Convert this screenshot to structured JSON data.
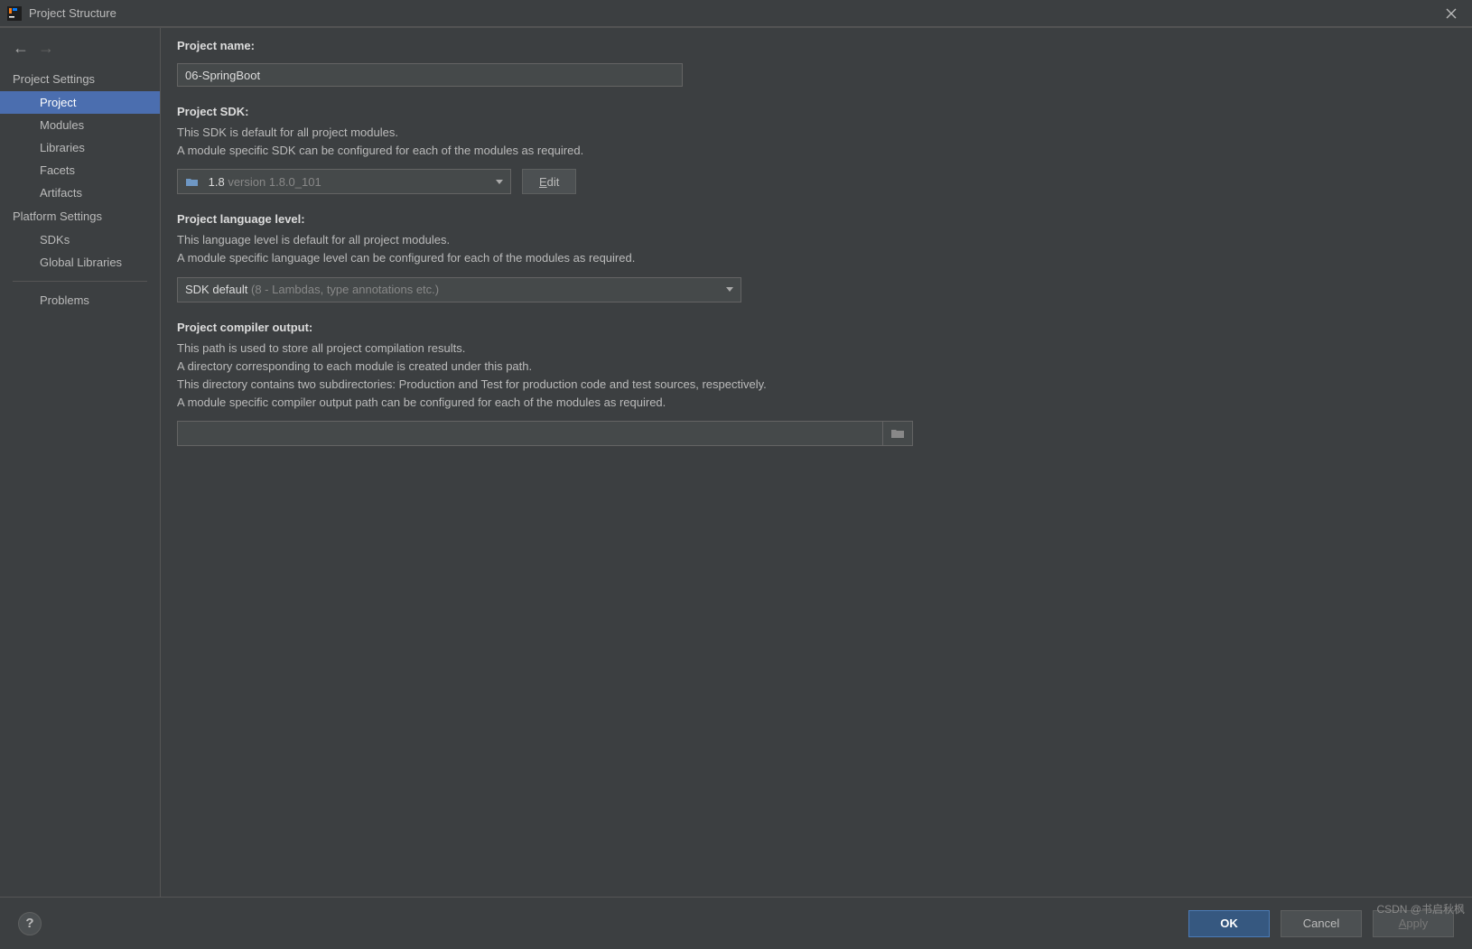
{
  "title": "Project Structure",
  "sidebar": {
    "heading1": "Project Settings",
    "items1": [
      "Project",
      "Modules",
      "Libraries",
      "Facets",
      "Artifacts"
    ],
    "heading2": "Platform Settings",
    "items2": [
      "SDKs",
      "Global Libraries"
    ],
    "problems": "Problems"
  },
  "projectName": {
    "label": "Project name:",
    "value": "06-SpringBoot"
  },
  "projectSdk": {
    "label": "Project SDK:",
    "desc1": "This SDK is default for all project modules.",
    "desc2": "A module specific SDK can be configured for each of the modules as required.",
    "selected_main": "1.8",
    "selected_sub": "version 1.8.0_101",
    "editLabel": "Edit"
  },
  "langLevel": {
    "label": "Project language level:",
    "desc1": "This language level is default for all project modules.",
    "desc2": "A module specific language level can be configured for each of the modules as required.",
    "selected_main": "SDK default",
    "selected_sub": "(8 - Lambdas, type annotations etc.)"
  },
  "compilerOutput": {
    "label": "Project compiler output:",
    "desc1": "This path is used to store all project compilation results.",
    "desc2": "A directory corresponding to each module is created under this path.",
    "desc3": "This directory contains two subdirectories: Production and Test for production code and test sources, respectively.",
    "desc4": "A module specific compiler output path can be configured for each of the modules as required.",
    "value": ""
  },
  "footer": {
    "ok": "OK",
    "cancel": "Cancel",
    "apply": "Apply"
  },
  "watermark": "CSDN @书启秋枫"
}
